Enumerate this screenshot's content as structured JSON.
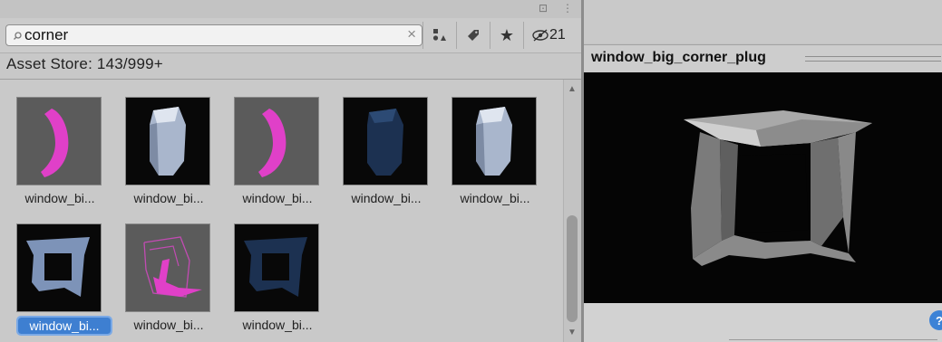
{
  "search": {
    "value": "corner",
    "clear_glyph": "×"
  },
  "toolbar": {
    "filter_by_type_icon": "asset-type-icon",
    "filter_by_label_icon": "tag-icon",
    "favorites_icon": "star-icon",
    "hidden_count": "21"
  },
  "status": {
    "text": "Asset Store: 143/999+"
  },
  "grid": {
    "items": [
      {
        "label": "window_bi...",
        "selected": false
      },
      {
        "label": "window_bi...",
        "selected": false
      },
      {
        "label": "window_bi...",
        "selected": false
      },
      {
        "label": "window_bi...",
        "selected": false
      },
      {
        "label": "window_bi...",
        "selected": false
      },
      {
        "label": "window_bi...",
        "selected": true
      },
      {
        "label": "window_bi...",
        "selected": false
      },
      {
        "label": "window_bi...",
        "selected": false
      }
    ]
  },
  "preview": {
    "title": "window_big_corner_plug"
  },
  "colors": {
    "selection": "#3e7fd1",
    "magenta": "#e040c8",
    "mesh_blue": "#7d93b8",
    "dark_blue": "#1c3151"
  }
}
